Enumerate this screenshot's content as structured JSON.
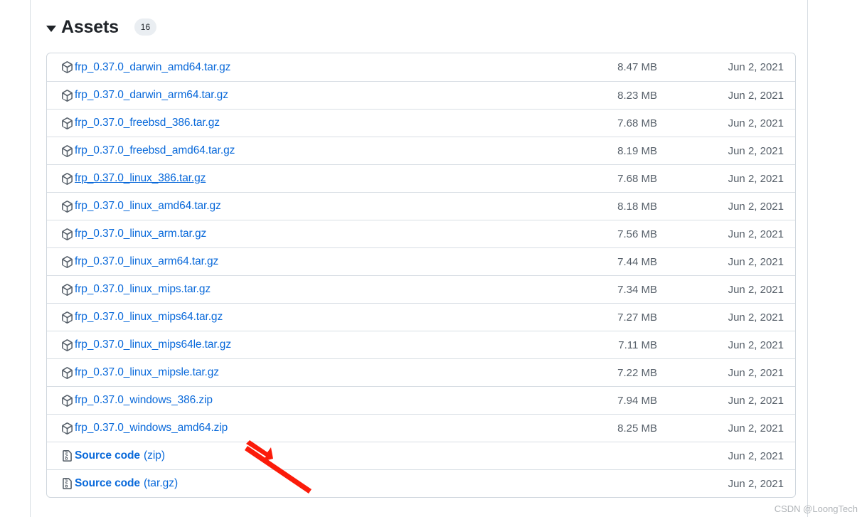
{
  "section": {
    "title": "Assets",
    "count": "16",
    "disclosure_icon": "triangle-down-icon"
  },
  "assets": {
    "package_icon": "package-icon",
    "file_zip_icon": "file-zip-icon",
    "rows": [
      {
        "name": "frp_0.37.0_darwin_amd64.tar.gz",
        "size": "8.47 MB",
        "date": "Jun 2, 2021"
      },
      {
        "name": "frp_0.37.0_darwin_arm64.tar.gz",
        "size": "8.23 MB",
        "date": "Jun 2, 2021"
      },
      {
        "name": "frp_0.37.0_freebsd_386.tar.gz",
        "size": "7.68 MB",
        "date": "Jun 2, 2021"
      },
      {
        "name": "frp_0.37.0_freebsd_amd64.tar.gz",
        "size": "8.19 MB",
        "date": "Jun 2, 2021"
      },
      {
        "name": "frp_0.37.0_linux_386.tar.gz",
        "size": "7.68 MB",
        "date": "Jun 2, 2021"
      },
      {
        "name": "frp_0.37.0_linux_amd64.tar.gz",
        "size": "8.18 MB",
        "date": "Jun 2, 2021"
      },
      {
        "name": "frp_0.37.0_linux_arm.tar.gz",
        "size": "7.56 MB",
        "date": "Jun 2, 2021"
      },
      {
        "name": "frp_0.37.0_linux_arm64.tar.gz",
        "size": "7.44 MB",
        "date": "Jun 2, 2021"
      },
      {
        "name": "frp_0.37.0_linux_mips.tar.gz",
        "size": "7.34 MB",
        "date": "Jun 2, 2021"
      },
      {
        "name": "frp_0.37.0_linux_mips64.tar.gz",
        "size": "7.27 MB",
        "date": "Jun 2, 2021"
      },
      {
        "name": "frp_0.37.0_linux_mips64le.tar.gz",
        "size": "7.11 MB",
        "date": "Jun 2, 2021"
      },
      {
        "name": "frp_0.37.0_linux_mipsle.tar.gz",
        "size": "7.22 MB",
        "date": "Jun 2, 2021"
      },
      {
        "name": "frp_0.37.0_windows_386.zip",
        "size": "7.94 MB",
        "date": "Jun 2, 2021"
      },
      {
        "name": "frp_0.37.0_windows_amd64.zip",
        "size": "8.25 MB",
        "date": "Jun 2, 2021"
      },
      {
        "name": "Source code",
        "format": "(zip)",
        "size": "",
        "date": "Jun 2, 2021"
      },
      {
        "name": "Source code",
        "format": "(tar.gz)",
        "size": "",
        "date": "Jun 2, 2021"
      }
    ],
    "hovered_row_index": 4,
    "source_code_start_index": 14
  },
  "annotation": {
    "arrow_color": "#fb1b0a",
    "points_at": "frp_0.37.0_windows_amd64.zip"
  },
  "watermark": {
    "text": "CSDN @LoongTech"
  },
  "colors": {
    "link": "#0969da",
    "text_muted": "#57606a",
    "text_strong": "#1f2328",
    "border": "#d0d7de",
    "divider": "#d8dee4",
    "badge_bg": "#eaeef2"
  }
}
